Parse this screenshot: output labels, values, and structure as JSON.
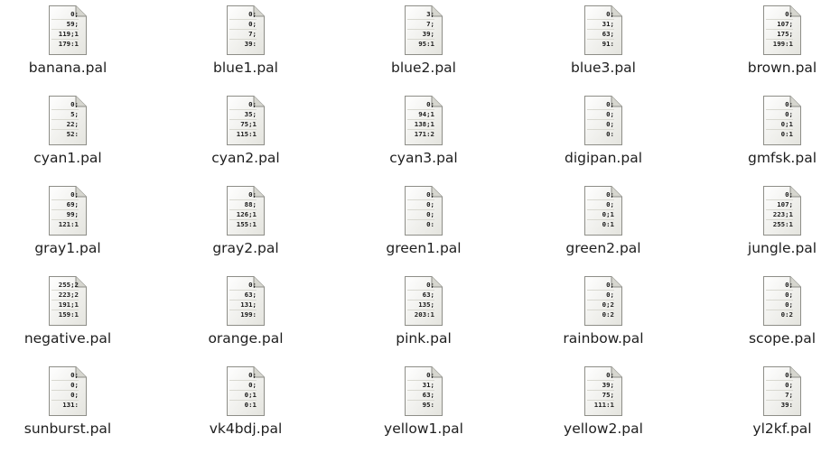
{
  "files": [
    {
      "name": "banana.pal",
      "preview": [
        "0;",
        "59;",
        "119;1",
        "179:1"
      ]
    },
    {
      "name": "blue1.pal",
      "preview": [
        "0;",
        "0;",
        "7;",
        "39:"
      ]
    },
    {
      "name": "blue2.pal",
      "preview": [
        "3;",
        "7;",
        "39;",
        "95:1"
      ]
    },
    {
      "name": "blue3.pal",
      "preview": [
        "0;",
        "31;",
        "63;",
        "91:"
      ]
    },
    {
      "name": "brown.pal",
      "preview": [
        "0;",
        "107;",
        "175;",
        "199:1"
      ]
    },
    {
      "name": "cyan1.pal",
      "preview": [
        "0;",
        "5;",
        "22;",
        "52:"
      ]
    },
    {
      "name": "cyan2.pal",
      "preview": [
        "0;",
        "35;",
        "75;1",
        "115:1"
      ]
    },
    {
      "name": "cyan3.pal",
      "preview": [
        "0;",
        "94;1",
        "138;1",
        "171:2"
      ]
    },
    {
      "name": "digipan.pal",
      "preview": [
        "0;",
        "0;",
        "0;",
        "0:"
      ]
    },
    {
      "name": "gmfsk.pal",
      "preview": [
        "0;",
        "0;",
        "0;1",
        "0:1"
      ]
    },
    {
      "name": "gray1.pal",
      "preview": [
        "0;",
        "69;",
        "99;",
        "121:1"
      ]
    },
    {
      "name": "gray2.pal",
      "preview": [
        "0;",
        "88;",
        "126;1",
        "155:1"
      ]
    },
    {
      "name": "green1.pal",
      "preview": [
        "0;",
        "0;",
        "0;",
        "0:"
      ]
    },
    {
      "name": "green2.pal",
      "preview": [
        "0;",
        "0;",
        "0;1",
        "0:1"
      ]
    },
    {
      "name": "jungle.pal",
      "preview": [
        "0;",
        "107;",
        "223;1",
        "255:1"
      ]
    },
    {
      "name": "negative.pal",
      "preview": [
        "255;2",
        "223;2",
        "191;1",
        "159:1"
      ]
    },
    {
      "name": "orange.pal",
      "preview": [
        "0;",
        "63;",
        "131;",
        "199:"
      ]
    },
    {
      "name": "pink.pal",
      "preview": [
        "0;",
        "63;",
        "135;",
        "203:1"
      ]
    },
    {
      "name": "rainbow.pal",
      "preview": [
        "0;",
        "0;",
        "0;2",
        "0:2"
      ]
    },
    {
      "name": "scope.pal",
      "preview": [
        "0;",
        "0;",
        "0;",
        "0:2"
      ]
    },
    {
      "name": "sunburst.pal",
      "preview": [
        "0;",
        "0;",
        "0;",
        "131:"
      ]
    },
    {
      "name": "vk4bdj.pal",
      "preview": [
        "0;",
        "0;",
        "0;1",
        "0:1"
      ]
    },
    {
      "name": "yellow1.pal",
      "preview": [
        "0;",
        "31;",
        "63;",
        "95:"
      ]
    },
    {
      "name": "yellow2.pal",
      "preview": [
        "0;",
        "39;",
        "75;",
        "111:1"
      ]
    },
    {
      "name": "yl2kf.pal",
      "preview": [
        "0;",
        "0;",
        "7;",
        "39:"
      ]
    }
  ]
}
